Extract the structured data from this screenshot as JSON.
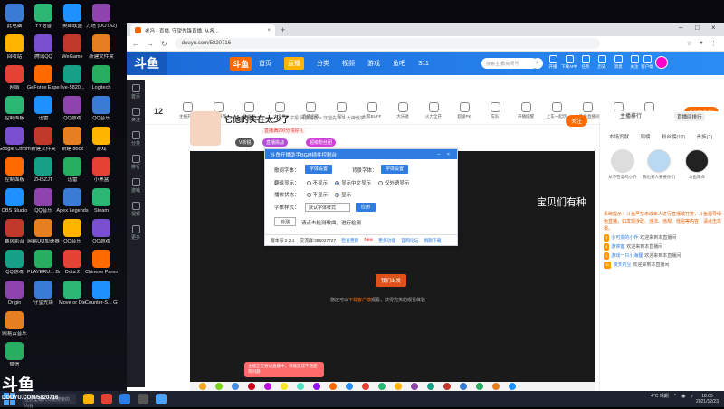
{
  "desktop": {
    "icons_col1": [
      "此电脑",
      "回收站",
      "网络",
      "控制面板",
      "Google Chrome",
      "控制面板",
      "OBS Studio",
      "暴风影音",
      "QQ游戏",
      "Origin",
      "网易云音乐",
      "微信"
    ],
    "icons_col2": [
      "YY语音",
      "腾讯QQ",
      "GeForce Experience",
      "迅雷",
      "新建文件夹",
      "ZHSZJT",
      "QQ音乐",
      "网易UU加速器",
      "PLAYERU... BATTLEGR...",
      "守望先锋"
    ],
    "icons_col3": [
      "英雄联盟",
      "WeGame",
      "live-5820...",
      "QQ游戏",
      "新建 docx",
      "迅雷",
      "Apex Legends",
      "QQ音乐",
      "Dota 2",
      "Move or Die"
    ],
    "icons_col4": [
      "刀塔 (DOTA2)",
      "新建文件夹",
      "Logitech",
      "QQ音乐",
      "游戏",
      "小黑盒",
      "Steam",
      "QQ游戏",
      "Chinese Parents",
      "Counter-S... Global Of..."
    ]
  },
  "browser": {
    "tab_title": "老冯 - 直播, 守望先锋直播, 从各...",
    "url": "douyu.com/5820716"
  },
  "douyu": {
    "logo": "斗鱼",
    "nav": [
      "首页",
      "直播",
      "分类",
      "视频",
      "游戏",
      "鱼吧",
      "S11"
    ],
    "search_placeholder": "搜索主播/房间号",
    "header_icons": [
      "开播",
      "下载APP",
      "任务",
      "历史",
      "消息",
      "关注",
      "客户端"
    ],
    "gift_items": [
      "主播开宝",
      "直播开奖",
      "粉丝团",
      "大宝贝",
      "直播宝箱",
      "积分",
      "火箭BUFF",
      "大乐透",
      "火力全开",
      "超级PK",
      "车队",
      "开播提醒",
      "上车一起玩",
      "小飞鱼直播间",
      "分享",
      "更多"
    ],
    "level": "12",
    "pc_button": "PC客户端",
    "room": {
      "title": "它他的实在太少了",
      "meta": "举报  网游竞技 > 守望先锋 > 大神教学",
      "tag1": "V新锐",
      "tag2": "直播挑战",
      "tag3": "超级粉丝团",
      "badge": "直播满200分领好礼"
    },
    "follow": "关注",
    "player": {
      "subtitle": "宝贝们有种",
      "enter_btn": "我们出发",
      "hint_prefix": "您还可以",
      "hint_link": "下载客户端",
      "hint_suffix": "观看，获得完美的观看体验",
      "pink_note": "主播正在尝试直播中，可能造成不稳定等问题"
    },
    "right_panel": {
      "tab_a": "主播排行",
      "tab_b": "直播间排行",
      "sub_tabs": [
        "本场贡献",
        "周榜",
        "粉丝榜(12)",
        "贵族(1)"
      ],
      "ranks": [
        "从不在意的小乔",
        "我也要人要要你们",
        "斗鱼观众"
      ],
      "system": "系统提示：斗鱼严禁未成年人进行直播或打赏，斗鱼倡导绿色直播，如发现涉政、违法、违规、低俗等内容，请点击举报。",
      "chats": [
        {
          "lv": "3",
          "name": "小可爱的小乔",
          "text": "欢迎来到本直播间"
        },
        {
          "lv": "8",
          "name": "游侠客",
          "text": "欢迎来到本直播间"
        },
        {
          "lv": "1",
          "name": "游戏一只小海狸",
          "text": "欢迎来到本直播间"
        },
        {
          "lv": "10",
          "name": "漫天的尘",
          "text": "欢迎来到本直播间"
        }
      ]
    }
  },
  "plugin": {
    "title": "斗鱼开播助手BGM插件控制台",
    "row1_label_a": "歌词字体：",
    "row1_btn_a": "字体设置",
    "row1_label_b": "背景字体：",
    "row1_btn_b": "字体设置",
    "row2_label": "翻译显示：",
    "row2_opts": [
      "不显示",
      "显示中文显示",
      "仅外语显示"
    ],
    "row3_label": "播放状态：",
    "row3_opts": [
      "不显示",
      "显示"
    ],
    "row4_label": "字体样式：",
    "row4_select": "默认字体样式",
    "row4_btn": "应用",
    "row5_btn": "检测",
    "row5_text": "请点击检测歌曲，进行检测",
    "foot_version": "版本号:2.2.1",
    "foot_qq": "交流群:385027727",
    "foot_link1": "检查更新",
    "foot_new": "New",
    "foot_link2": "更多功能",
    "foot_link3": "官网论坛",
    "foot_link4": "捐款下载"
  },
  "taskbar": {
    "search": "在这里输入你要搜索的内容",
    "weather": "4°C 晴朗",
    "time": "18:05",
    "date": "2021/12/23"
  },
  "watermark": {
    "logo": "斗鱼",
    "url": "DOUYU.COM/5820716"
  },
  "colors": {
    "douyu_blue": "#2b8cf5",
    "douyu_orange": "#ff6a00",
    "plugin_blue": "#2f7de0"
  }
}
